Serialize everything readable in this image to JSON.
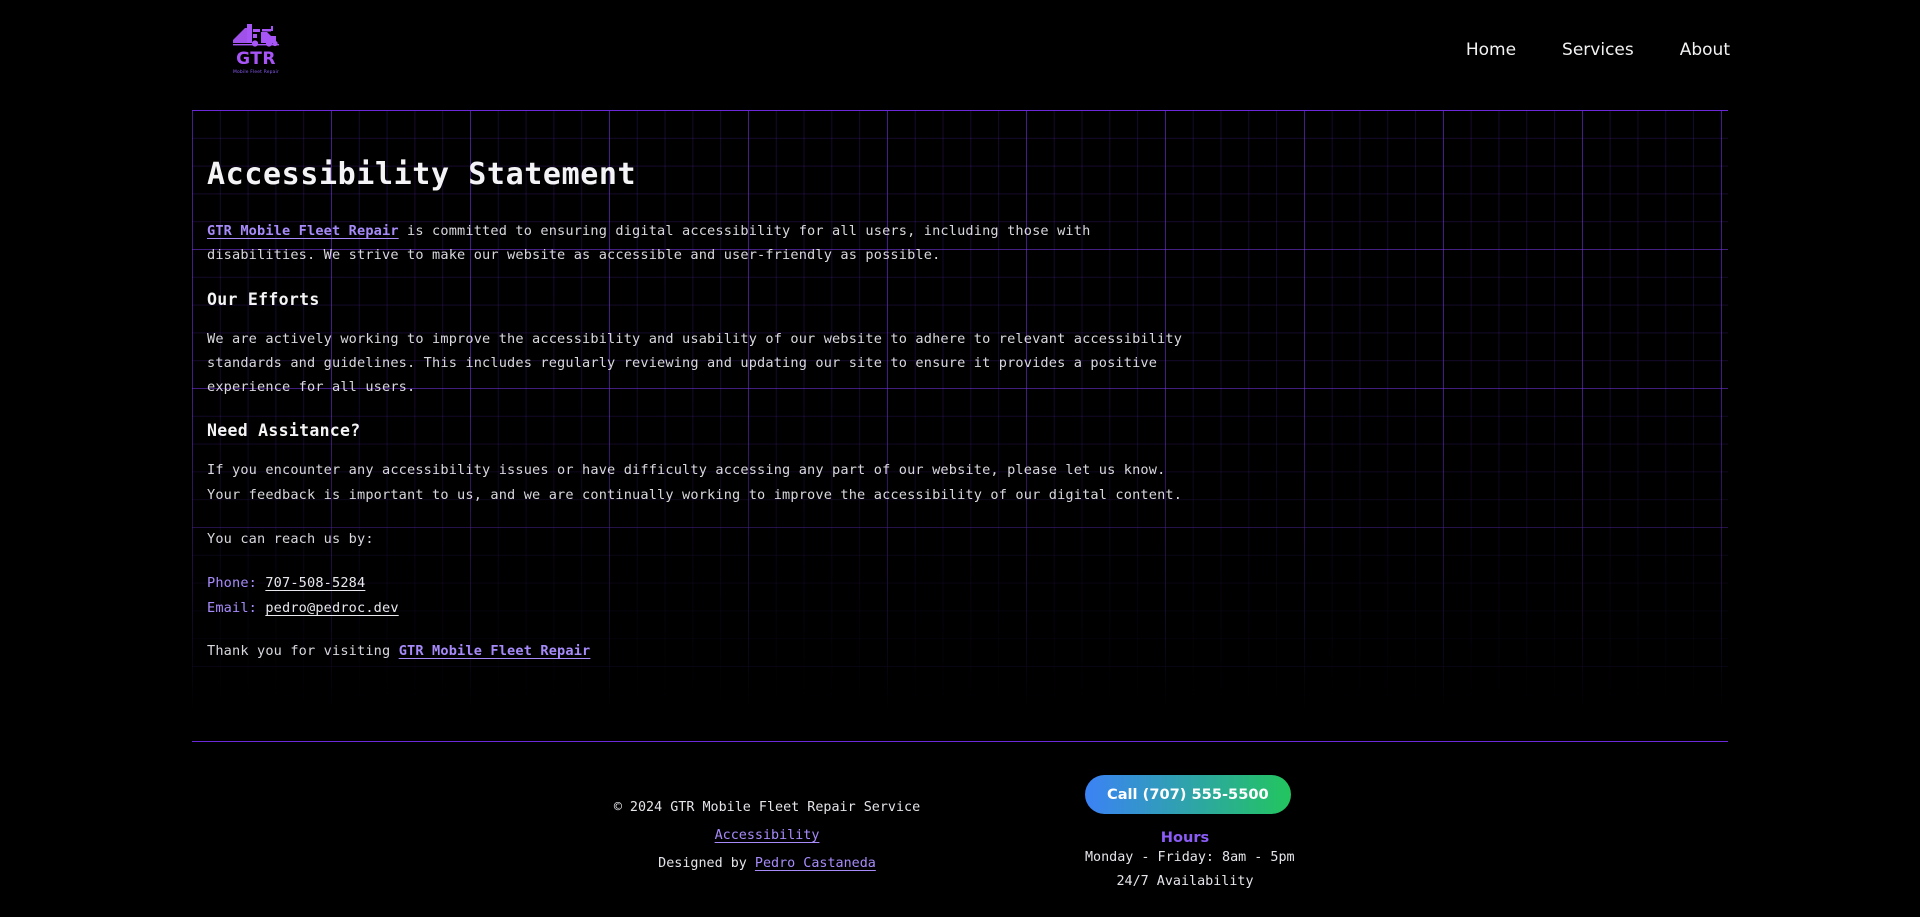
{
  "header": {
    "logo": {
      "icon": "semi-truck-icon",
      "wordmark": "GTR",
      "tagline": "Mobile Fleet Repair"
    },
    "nav": [
      {
        "label": "Home"
      },
      {
        "label": "Services"
      },
      {
        "label": "About"
      }
    ]
  },
  "main": {
    "title": "Accessibility Statement",
    "intro": {
      "link_text": "GTR Mobile Fleet Repair",
      "rest": " is committed to ensuring digital accessibility for all users, including those with disabilities. We strive to make our website as accessible and user-friendly as possible."
    },
    "efforts": {
      "heading": "Our Efforts",
      "body": "We are actively working to improve the accessibility and usability of our website to adhere to relevant accessibility standards and guidelines. This includes regularly reviewing and updating our site to ensure it provides a positive experience for all users."
    },
    "assistance": {
      "heading": "Need Assitance?",
      "body": "If you encounter any accessibility issues or have difficulty accessing any part of our website, please let us know. Your feedback is important to us, and we are continually working to improve the accessibility of our digital content.",
      "reach_line": "You can reach us by:",
      "phone_label": "Phone: ",
      "phone_value": "707-508-5284",
      "email_label": "Email: ",
      "email_value": "pedro@pedroc.dev"
    },
    "thanks": {
      "prefix": "Thank you for visiting ",
      "link_text": "GTR Mobile Fleet Repair"
    }
  },
  "footer": {
    "copyright": "© 2024 GTR Mobile Fleet Repair Service",
    "accessibility_link": "Accessibility",
    "designed_prefix": "Designed by ",
    "designer_link": "Pedro Castaneda",
    "call_button": "Call (707) 555-5500",
    "hours_title": "Hours",
    "hours_weekday": "Monday - Friday: 8am - 5pm",
    "hours_availability": "24/7 Availability"
  },
  "colors": {
    "background": "#000000",
    "accent_purple": "#a78bfa",
    "rule_purple": "#6d28d9",
    "logo_purple": "#a855f7",
    "text": "#d8d8de",
    "heading": "#f4f4f6",
    "button_gradient_start": "#3b82f6",
    "button_gradient_end": "#22c55e"
  }
}
